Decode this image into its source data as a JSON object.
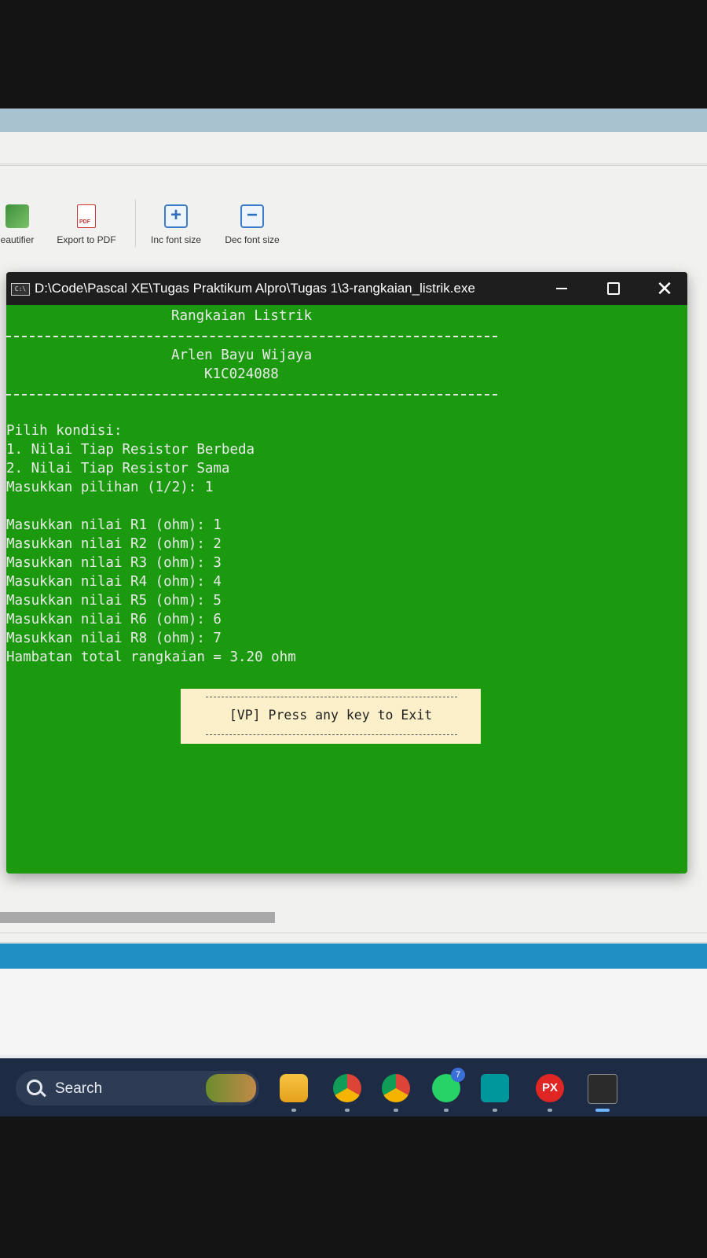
{
  "toolbar": {
    "beautifier_label": "eautifier",
    "export_pdf_label": "Export to PDF",
    "inc_font_label": "Inc font size",
    "dec_font_label": "Dec font size"
  },
  "console_window": {
    "title": "D:\\Code\\Pascal XE\\Tugas Praktikum Alpro\\Tugas 1\\3-rangkaian_listrik.exe",
    "app_icon": "C:\\",
    "background": "#1c9a0f"
  },
  "terminal": {
    "header_title": "Rangkaian Listrik",
    "author_name": "Arlen Bayu Wijaya",
    "author_id": "K1C024088",
    "menu_lines": [
      "Pilih kondisi:",
      "1. Nilai Tiap Resistor Berbeda",
      "2. Nilai Tiap Resistor Sama",
      "Masukkan pilihan (1/2): 1"
    ],
    "input_lines": [
      "Masukkan nilai R1 (ohm): 1",
      "Masukkan nilai R2 (ohm): 2",
      "Masukkan nilai R3 (ohm): 3",
      "Masukkan nilai R4 (ohm): 4",
      "Masukkan nilai R5 (ohm): 5",
      "Masukkan nilai R6 (ohm): 6",
      "Masukkan nilai R8 (ohm): 7",
      "Hambatan total rangkaian = 3.20 ohm"
    ],
    "exit_prompt": "[VP] Press any key to Exit"
  },
  "taskbar": {
    "search_label": "Search",
    "icons": [
      "file-explorer-icon",
      "chrome-icon",
      "chrome-profile-icon",
      "whatsapp-icon",
      "arduino-icon",
      "px-icon",
      "terminal-icon"
    ],
    "badges": {
      "whatsapp": "7"
    },
    "px_label": "PX"
  }
}
